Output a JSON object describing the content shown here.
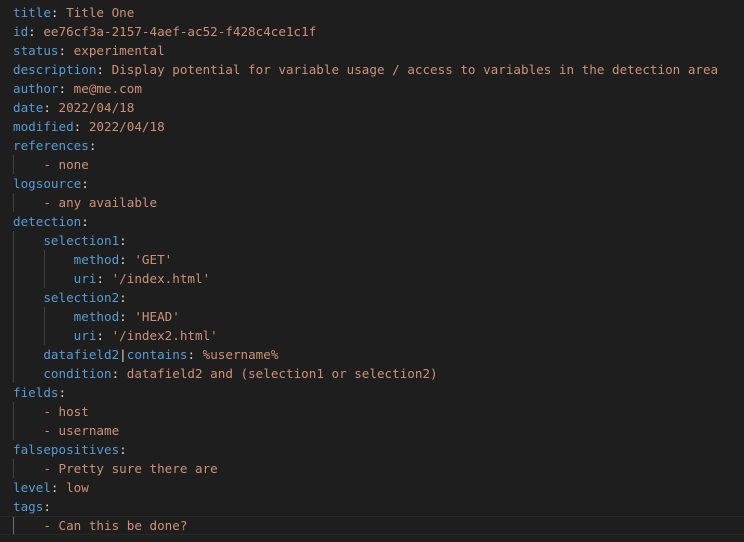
{
  "lines": {
    "title": {
      "key": "title",
      "value": "Title One"
    },
    "id": {
      "key": "id",
      "value": "ee76cf3a-2157-4aef-ac52-f428c4ce1c1f"
    },
    "status": {
      "key": "status",
      "value": "experimental"
    },
    "description": {
      "key": "description",
      "value": "Display potential for variable usage / access to variables in the detection area"
    },
    "author": {
      "key": "author",
      "value": "me@me.com"
    },
    "date": {
      "key": "date",
      "value": "2022/04/18"
    },
    "modified": {
      "key": "modified",
      "value": "2022/04/18"
    },
    "references": {
      "key": "references",
      "items": [
        "- none"
      ]
    },
    "logsource": {
      "key": "logsource",
      "items": [
        "- any available"
      ]
    },
    "detection": {
      "key": "detection",
      "selection1": {
        "key": "selection1",
        "method_key": "method",
        "method_value": "'GET'",
        "uri_key": "uri",
        "uri_value": "'/index.html'"
      },
      "selection2": {
        "key": "selection2",
        "method_key": "method",
        "method_value": "'HEAD'",
        "uri_key": "uri",
        "uri_value": "'/index2.html'"
      },
      "datafield_key_a": "datafield2",
      "datafield_key_b": "contains",
      "datafield_value": "%username%",
      "condition_key": "condition",
      "condition_value": "datafield2 and (selection1 or selection2)"
    },
    "fields": {
      "key": "fields",
      "items": [
        "- host",
        "- username"
      ]
    },
    "falsepositives": {
      "key": "falsepositives",
      "items": [
        "- Pretty sure there are"
      ]
    },
    "level": {
      "key": "level",
      "value": "low"
    },
    "tags": {
      "key": "tags",
      "items": [
        "- Can this be done?"
      ]
    }
  },
  "colors": {
    "background": "#1e1e1e",
    "key": "#569cd6",
    "string": "#ce9178",
    "punctuation": "#d4d4d4"
  }
}
